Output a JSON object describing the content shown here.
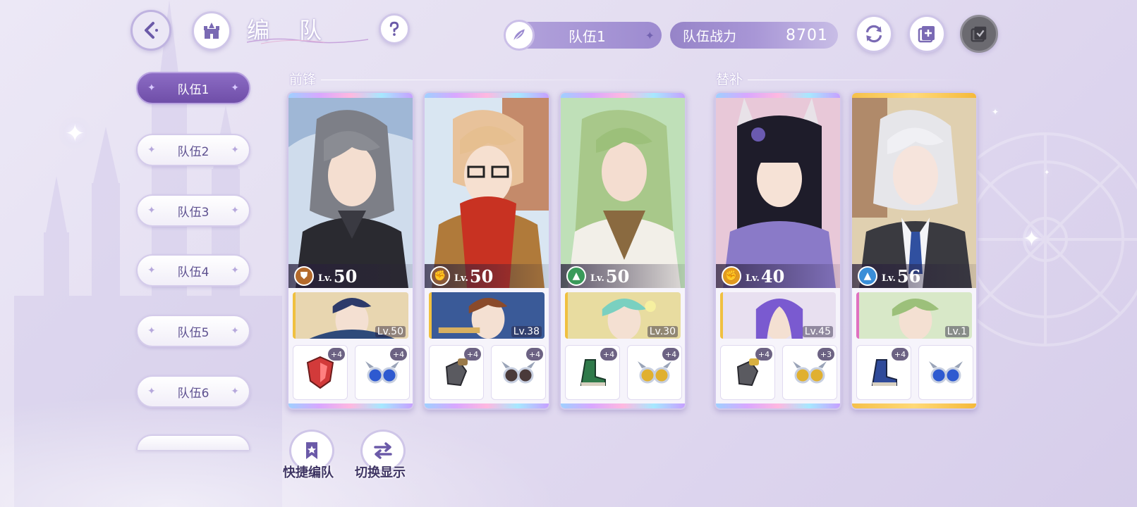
{
  "header": {
    "title": "编  队",
    "team_name": "队伍1",
    "power_label": "队伍战力",
    "power_value": "8701"
  },
  "icons": {
    "back": "back-arrow-icon",
    "home": "castle-icon",
    "help": "question-icon",
    "team_emblem": "feather-icon",
    "refresh": "refresh-icon",
    "add": "add-copy-icon",
    "confirm": "checklist-icon"
  },
  "team_tabs": [
    {
      "label": "队伍1",
      "active": true
    },
    {
      "label": "队伍2",
      "active": false
    },
    {
      "label": "队伍3",
      "active": false
    },
    {
      "label": "队伍4",
      "active": false
    },
    {
      "label": "队伍5",
      "active": false
    },
    {
      "label": "队伍6",
      "active": false
    }
  ],
  "sections": {
    "front": "前锋",
    "reserve": "替补"
  },
  "cards": [
    {
      "lv_prefix": "Lv.",
      "level": "50",
      "class_color": "#b46a2c",
      "class_icon": "shield-class-icon",
      "partner_level": "Lv.50",
      "equip": [
        {
          "item": "red-shield-icon",
          "plus": "+4"
        },
        {
          "item": "blue-wings-icon",
          "plus": "+4"
        }
      ],
      "gold": false
    },
    {
      "lv_prefix": "Lv.",
      "level": "50",
      "class_color": "#8a5a3a",
      "class_icon": "fist-class-icon",
      "partner_level": "Lv.38",
      "equip": [
        {
          "item": "gauntlet-icon",
          "plus": "+4"
        },
        {
          "item": "silver-wings-icon",
          "plus": "+4"
        }
      ],
      "gold": false
    },
    {
      "lv_prefix": "Lv.",
      "level": "50",
      "class_color": "#3a9a5a",
      "class_icon": "boot-class-icon",
      "partner_level": "Lv.30",
      "equip": [
        {
          "item": "green-boot-icon",
          "plus": "+4"
        },
        {
          "item": "gold-wings-icon",
          "plus": "+4"
        }
      ],
      "gold": false
    },
    {
      "lv_prefix": "Lv.",
      "level": "40",
      "class_color": "#e09a20",
      "class_icon": "fist-class-icon",
      "partner_level": "Lv.45",
      "equip": [
        {
          "item": "gauntlet-icon",
          "plus": "+4"
        },
        {
          "item": "gold-wings-icon",
          "plus": "+3"
        }
      ],
      "gold": false
    },
    {
      "lv_prefix": "Lv.",
      "level": "56",
      "class_color": "#3a8ed8",
      "class_icon": "boot-class-icon",
      "partner_level": "Lv.1",
      "equip": [
        {
          "item": "blue-boot-icon",
          "plus": "+4"
        },
        {
          "item": "blue-wings-icon",
          "plus": ""
        }
      ],
      "gold": true
    }
  ],
  "bottom": {
    "quick_label": "快捷编队",
    "switch_label": "切换显示"
  },
  "colors": {
    "accent": "#7a5cb8",
    "tab_active": "#7250ab",
    "background": "#e6e1f3"
  }
}
